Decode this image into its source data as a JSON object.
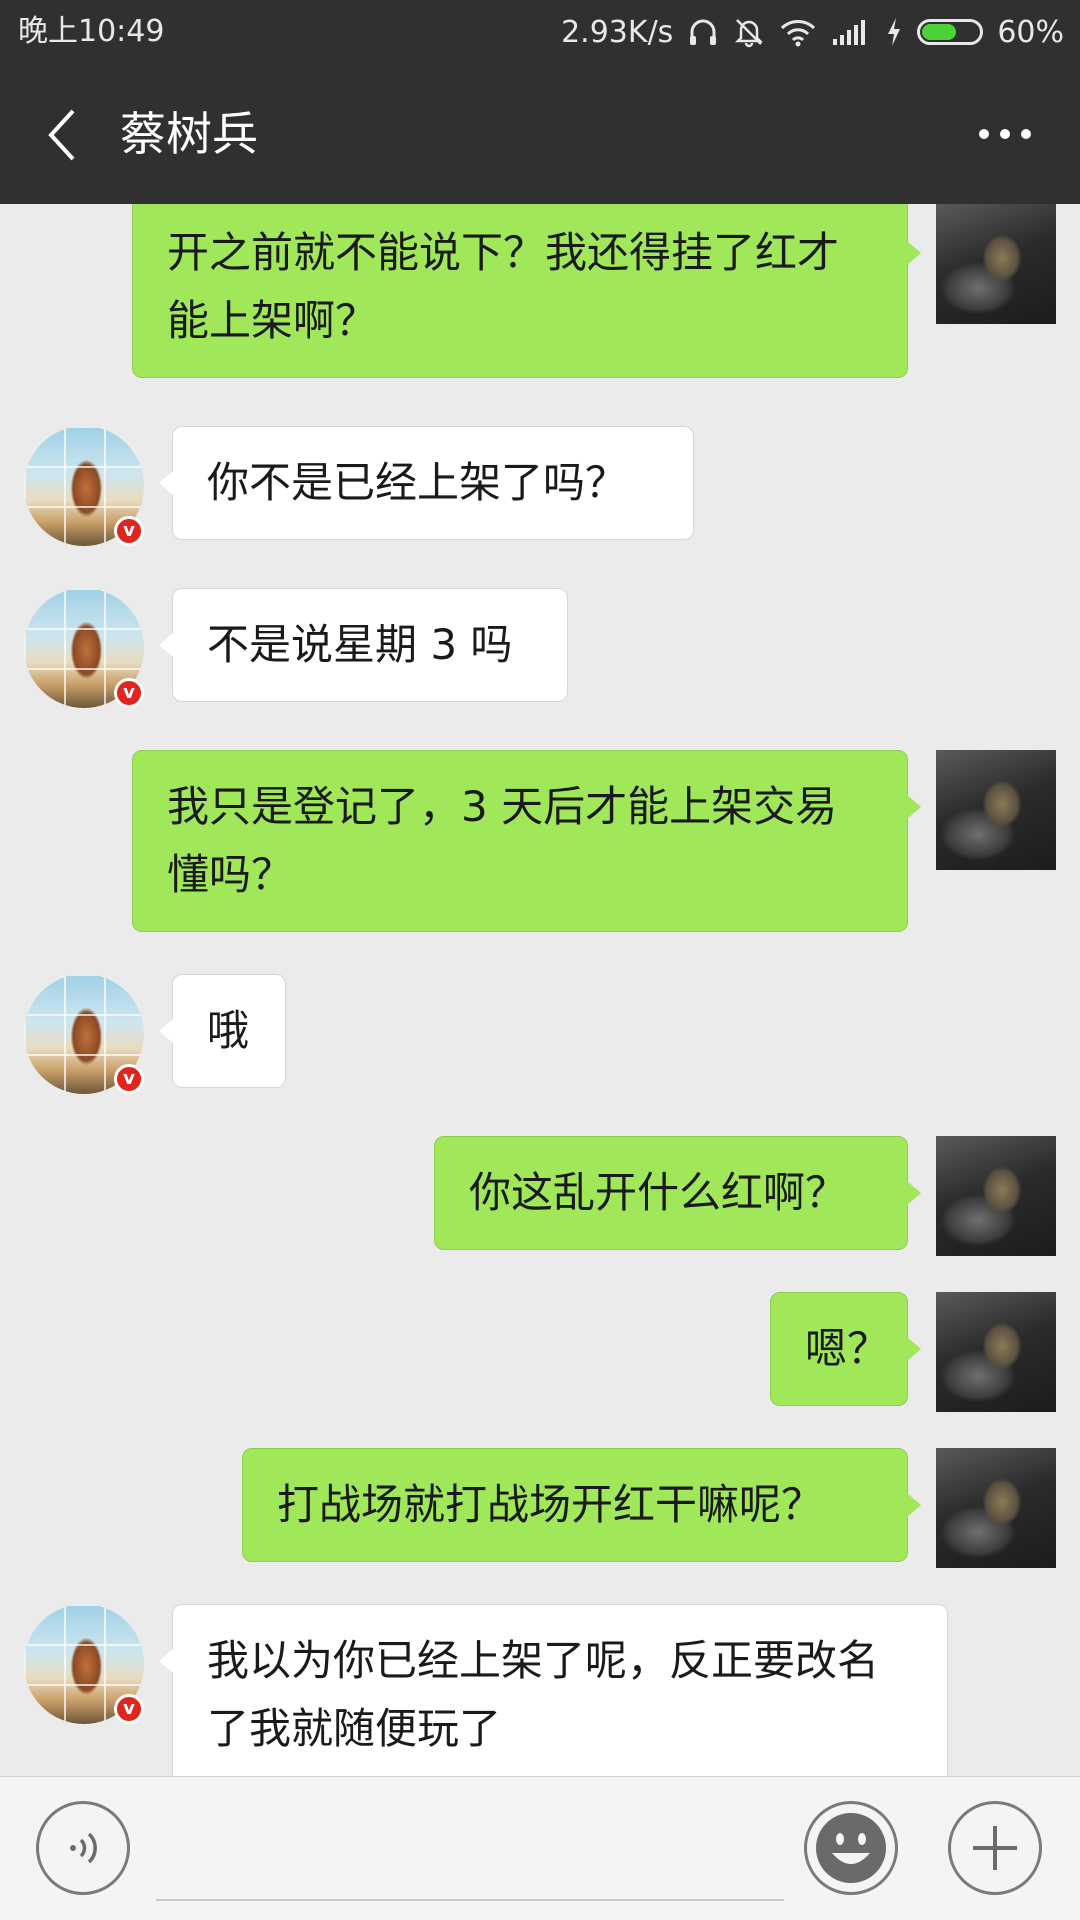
{
  "status_bar": {
    "time": "晚上10:49",
    "net_speed": "2.93K/s",
    "battery_percent": "60%",
    "battery_level": 0.6,
    "icons": [
      "headphones-icon",
      "mute-bell-icon",
      "wifi-icon",
      "signal-icon",
      "charging-icon",
      "battery-icon"
    ]
  },
  "header": {
    "title": "蔡树兵",
    "back_icon": "chevron-left-icon",
    "more_icon": "more-dots-icon"
  },
  "messages": [
    {
      "sender": "me",
      "text": "开之前就不能说下？我还得挂了红才能上架啊？"
    },
    {
      "sender": "them",
      "text": "你不是已经上架了吗？"
    },
    {
      "sender": "them",
      "text": "不是说星期 3 吗"
    },
    {
      "sender": "me",
      "text": "我只是登记了，3 天后才能上架交易懂吗？"
    },
    {
      "sender": "them",
      "text": "哦"
    },
    {
      "sender": "me",
      "text": "你这乱开什么红啊？"
    },
    {
      "sender": "me",
      "text": "嗯？"
    },
    {
      "sender": "me",
      "text": "打战场就打战场开红干嘛呢？"
    },
    {
      "sender": "them",
      "text": "我以为你已经上架了呢，反正要改名了我就随便玩了"
    }
  ],
  "badge": {
    "text": "v",
    "color": "#e0241e"
  },
  "input_bar": {
    "placeholder": "",
    "voice_icon": "voice-icon",
    "emoji_icon": "emoji-icon",
    "plus_icon": "plus-icon"
  },
  "colors": {
    "my_bubble": "#a0e75a",
    "their_bubble": "#ffffff",
    "header_bg": "#303030",
    "chat_bg": "#ebebeb"
  }
}
